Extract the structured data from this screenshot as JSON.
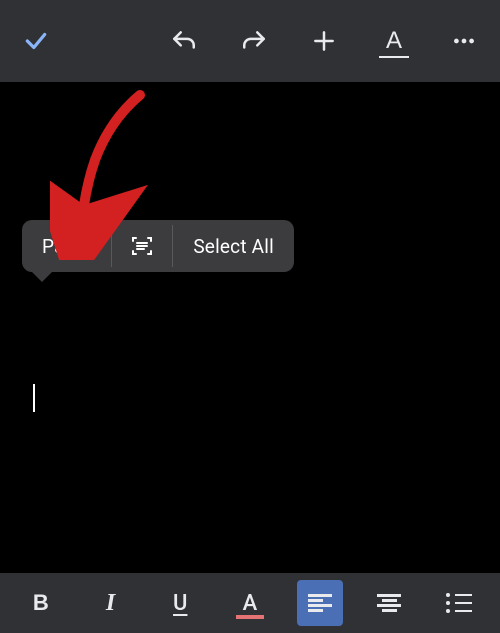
{
  "context_menu": {
    "paste_label": "Paste",
    "select_all_label": "Select All"
  },
  "icons": {
    "check": "check-icon",
    "undo": "undo-icon",
    "redo": "redo-icon",
    "add": "plus-icon",
    "text_format": "text-format-icon",
    "more": "more-horizontal-icon",
    "scan": "scan-text-icon",
    "bold": "bold-icon",
    "italic": "italic-icon",
    "underline": "underline-icon",
    "text_color": "text-color-icon",
    "align_left": "align-left-icon",
    "align_center": "align-center-icon",
    "bulleted_list": "bulleted-list-icon"
  },
  "format_glyphs": {
    "text_format_A": "A",
    "bold_B": "B",
    "italic_I": "I",
    "underline_U": "U",
    "text_color_A": "A"
  },
  "colors": {
    "text_color_underline": "#e57373"
  },
  "bottom_toolbar": {
    "active_index": 4
  }
}
